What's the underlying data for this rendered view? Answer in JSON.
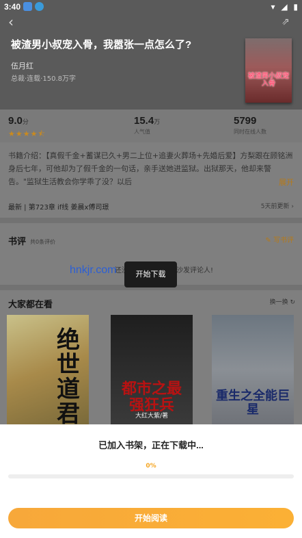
{
  "status_bar": {
    "time": "3:40"
  },
  "book": {
    "title": "被渣男小叔宠入骨，我嚣张一点怎么了?",
    "author": "伍月红",
    "meta": "总裁·连载·150.8万字",
    "cover_text": "被渣男小叔宠入骨"
  },
  "stats": {
    "rating": "9.0",
    "rating_unit": "分",
    "stars": 4.5,
    "popularity": "15.4",
    "popularity_unit": "万",
    "popularity_label": "人气值",
    "readers": "5799",
    "readers_label": "同时在线人数"
  },
  "intro": {
    "text": "书籍介绍：【真假千金+蓄谋已久+男二上位+追妻火葬场+先婚后爱】方梨跟在顾铭洲身后七年，可他却为了假千金的一句话，亲手送她进监狱。出狱那天，他却来警告。\"监狱生活教会你学乖了没？以后",
    "expand_label": "展开"
  },
  "latest": {
    "text": "最新 | 第723章 if线 姜晨x傅司璟",
    "time": "5天前更新"
  },
  "reviews": {
    "title": "书评",
    "count": "共0条评价",
    "write_label": "写书评",
    "empty_text": "还没有书评，快来抢沙发评论人!"
  },
  "watermark": "hnkjr.com",
  "recommend": {
    "title": "大家都在看",
    "refresh_label": "换一换",
    "books": [
      {
        "cover_text": "绝世道君"
      },
      {
        "cover_text": "都市之最强狂兵",
        "cover_sub": "大红大紫/著"
      },
      {
        "cover_text": "重生之全能巨星"
      }
    ]
  },
  "toast": "开始下载",
  "download_sheet": {
    "title": "已加入书架，正在下载中...",
    "percent": "0%",
    "progress": 0,
    "read_button": "开始阅读"
  },
  "colors": {
    "accent": "#f5a623",
    "star": "#c98a1f"
  }
}
